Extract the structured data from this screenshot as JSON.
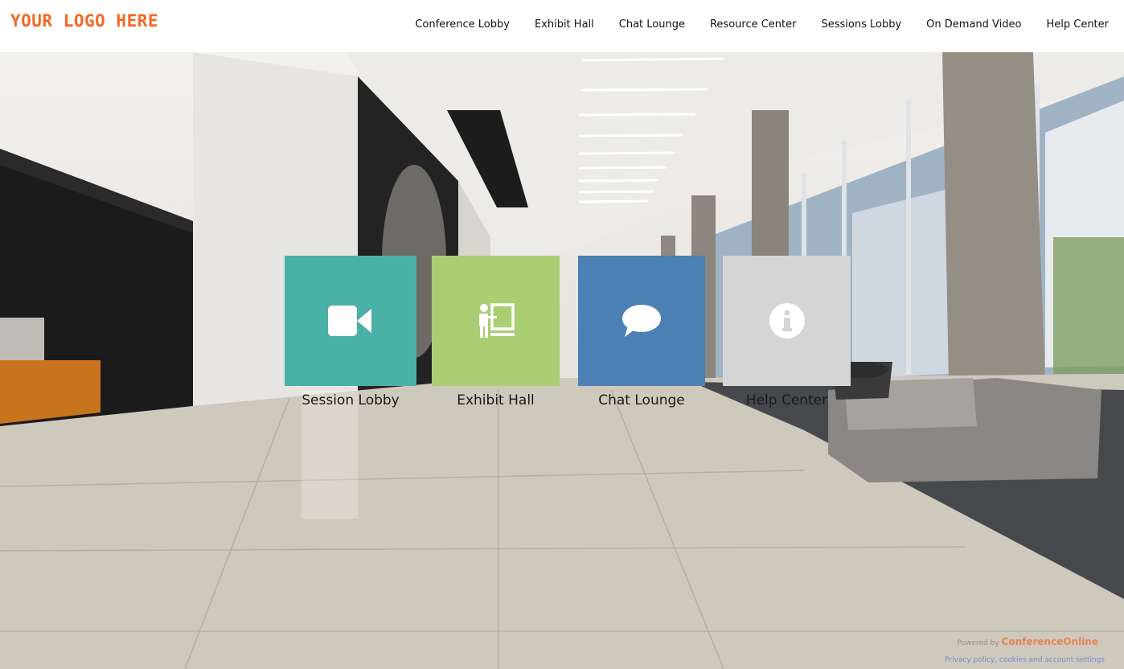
{
  "header": {
    "logo_text": "YOUR LOGO HERE",
    "nav": [
      {
        "label": "Conference Lobby"
      },
      {
        "label": "Exhibit Hall"
      },
      {
        "label": "Chat Lounge"
      },
      {
        "label": "Resource Center"
      },
      {
        "label": "Sessions Lobby"
      },
      {
        "label": "On Demand Video"
      },
      {
        "label": "Help Center"
      }
    ]
  },
  "tiles": [
    {
      "label": "Session Lobby",
      "icon": "video-camera-icon",
      "color": "#4bb0a6"
    },
    {
      "label": "Exhibit Hall",
      "icon": "presenter-board-icon",
      "color": "#a9cf72"
    },
    {
      "label": "Chat Lounge",
      "icon": "speech-bubble-icon",
      "color": "#4a80b4"
    },
    {
      "label": "Help Center",
      "icon": "info-icon",
      "color": "#d5d5d5"
    }
  ],
  "footer": {
    "powered_by": "Powered by",
    "brand": "ConferenceOnline",
    "privacy_link": "Privacy policy, cookies and account settings"
  },
  "colors": {
    "logo": "#f26a25"
  }
}
